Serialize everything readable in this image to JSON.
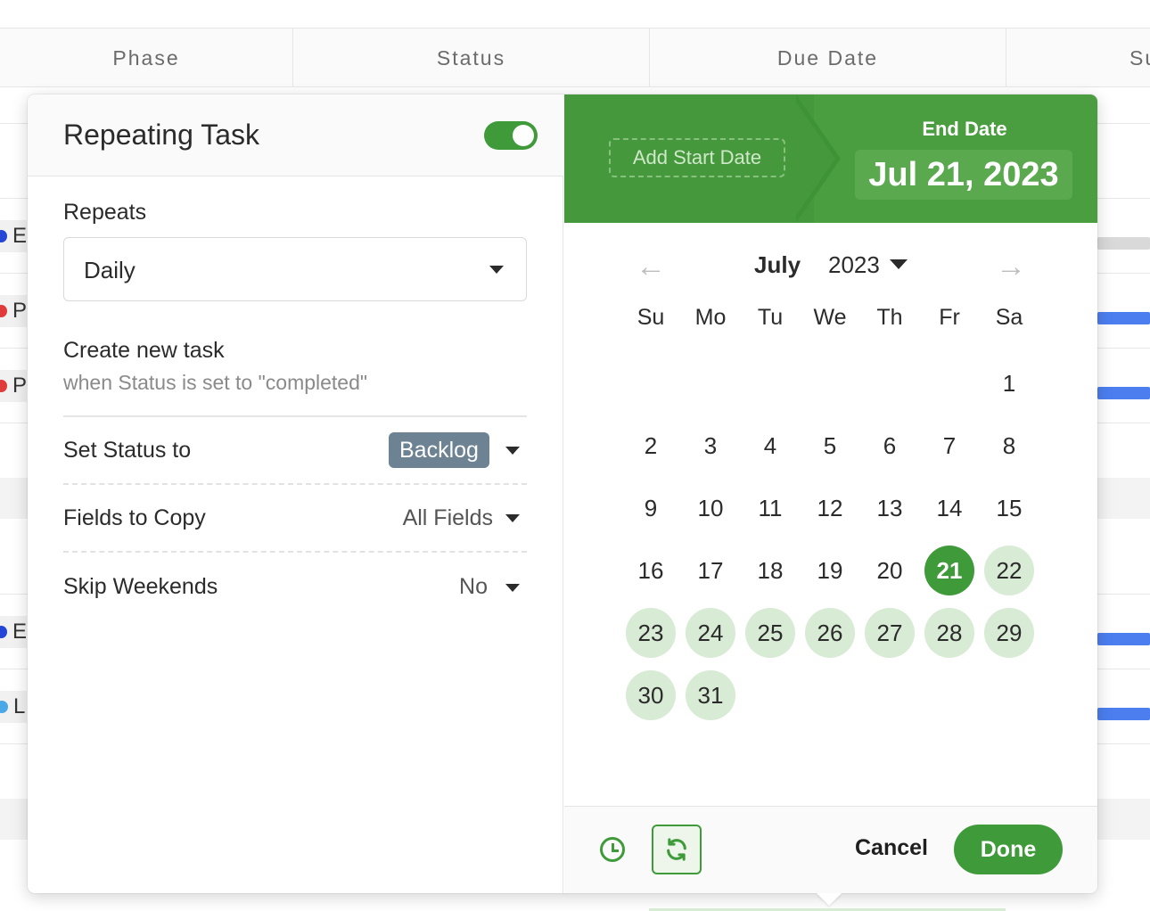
{
  "table": {
    "columns": [
      "Phase",
      "Status",
      "Due Date",
      "Su"
    ],
    "rows": [
      {
        "letter": "E",
        "color": "#2346d6"
      },
      {
        "letter": "P",
        "color": "#e03a3a"
      },
      {
        "letter": "P",
        "color": "#e03a3a"
      },
      {
        "letter": "E",
        "color": "#2346d6"
      },
      {
        "letter": "L",
        "color": "#4aa7e8"
      }
    ]
  },
  "repeat_panel": {
    "title": "Repeating Task",
    "toggle_on": true,
    "repeats_label": "Repeats",
    "repeats_value": "Daily",
    "create_label": "Create new task",
    "create_sub": "when Status is set to \"completed\"",
    "status_label": "Set Status to",
    "status_value": "Backlog",
    "fields_label": "Fields to Copy",
    "fields_value": "All Fields",
    "skip_label": "Skip Weekends",
    "skip_value": "No"
  },
  "calendar": {
    "add_start": "Add Start Date",
    "end_label": "End Date",
    "end_date": "Jul 21, 2023",
    "month": "July",
    "year": "2023",
    "weekdays": [
      "Su",
      "Mo",
      "Tu",
      "We",
      "Th",
      "Fr",
      "Sa"
    ],
    "first_weekday_index": 6,
    "days_in_month": 31,
    "selected_day": 21,
    "range_through": 31,
    "colors": {
      "accent": "#3f9a3a",
      "range": "#d8ebd5",
      "header": "#4a9e3f"
    },
    "cancel": "Cancel",
    "done": "Done",
    "icons": [
      "arrow-left-icon",
      "arrow-right-icon",
      "clock-icon",
      "refresh-icon"
    ]
  }
}
